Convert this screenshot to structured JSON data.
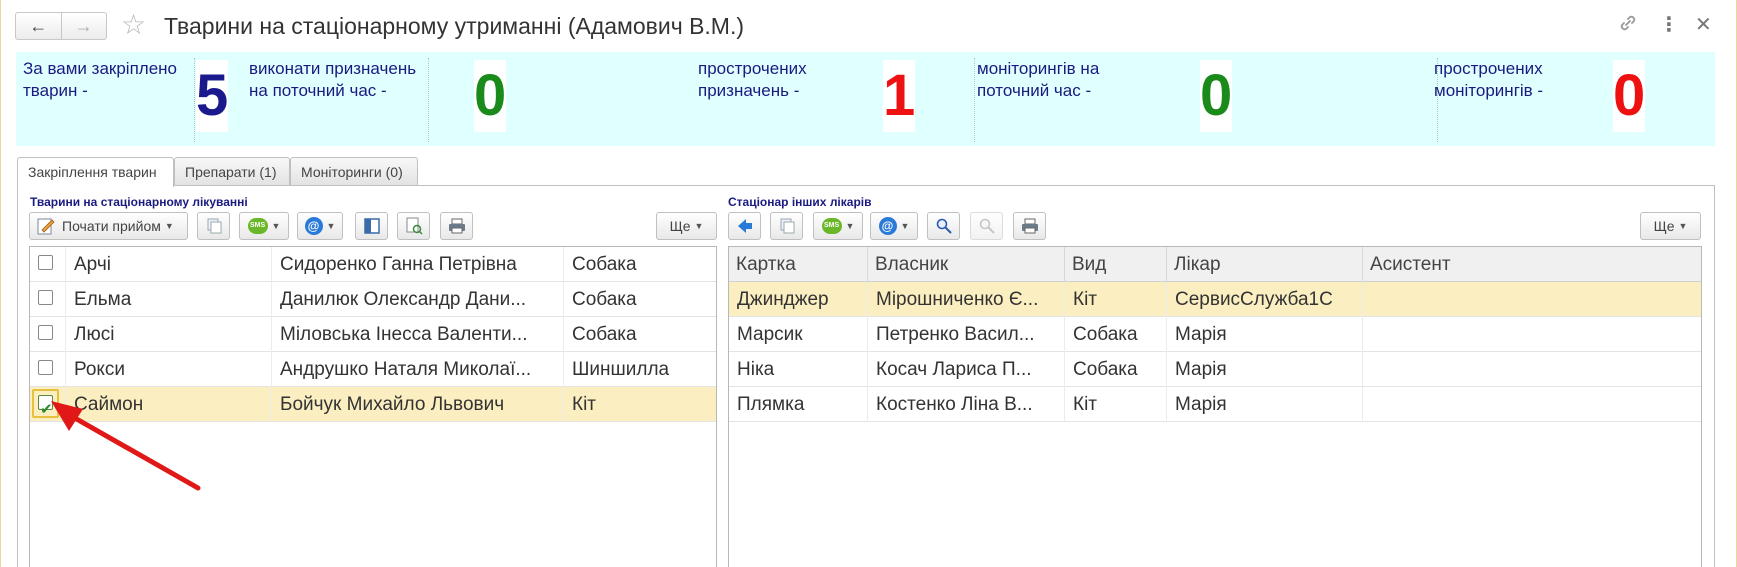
{
  "window": {
    "title": "Тварини на стаціонарному утриманні (Адамович В.М.)",
    "back_icon": "←",
    "forward_icon": "→",
    "favorite_icon": "☆",
    "link_icon": "🔗",
    "menu_icon": "⋮",
    "close_icon": "✕"
  },
  "info": {
    "assigned": {
      "label": "За вами закріплено тварин -",
      "value": "5",
      "color": "#1a1a8c"
    },
    "todo_appointments": {
      "label": "виконати призначень на поточний час -",
      "value": "0",
      "color": "#1a8a1a"
    },
    "overdue_appointments": {
      "label": "прострочених призначень -",
      "value": "1",
      "color": "#ee1111"
    },
    "monitorings_now": {
      "label": "моніторингів на поточний час -",
      "value": "0",
      "color": "#1a8a1a"
    },
    "overdue_monitorings": {
      "label": "прострочених моніторингів -",
      "value": "0",
      "color": "#ee1111"
    }
  },
  "tabs": [
    {
      "label": "Закріплення тварин",
      "active": true
    },
    {
      "label": "Препарати (1)",
      "active": false
    },
    {
      "label": "Моніторинги (0)",
      "active": false
    }
  ],
  "left": {
    "group_label": "Тварини на стаціонарному лікуванні",
    "toolbar": {
      "start_appointment": "Почати прийом",
      "more": "Ще",
      "sms_label": "SMS",
      "email_label": "@"
    },
    "rows": [
      {
        "checked": false,
        "name": "Арчі",
        "owner": "Сидоренко Ганна Петрівна",
        "species": "Собака",
        "selected": false
      },
      {
        "checked": false,
        "name": "Ельма",
        "owner": "Данилюк Олександр Дани...",
        "species": "Собака",
        "selected": false
      },
      {
        "checked": false,
        "name": "Люсі",
        "owner": "Міловська Інесса Валенти...",
        "species": "Собака",
        "selected": false
      },
      {
        "checked": false,
        "name": "Рокси",
        "owner": "Андрушко Наталя Миколаї...",
        "species": "Шиншилла",
        "selected": false
      },
      {
        "checked": true,
        "name": "Саймон",
        "owner": "Бойчук Михайло Львович",
        "species": "Кіт",
        "selected": true
      }
    ]
  },
  "right": {
    "group_label": "Стаціонар інших лікарів",
    "toolbar": {
      "more": "Ще",
      "sms_label": "SMS",
      "email_label": "@"
    },
    "columns": [
      "Картка",
      "Власник",
      "Вид",
      "Лікар",
      "Асистент"
    ],
    "rows": [
      {
        "card": "Джинджер",
        "owner": "Мірошниченко Є...",
        "species": "Кіт",
        "doctor": "СервисСлужба1С",
        "assistant": "",
        "selected": true
      },
      {
        "card": "Марсик",
        "owner": "Петренко Васил...",
        "species": "Собака",
        "doctor": "Марія",
        "assistant": "",
        "selected": false
      },
      {
        "card": "Ніка",
        "owner": "Косач Лариса П...",
        "species": "Собака",
        "doctor": "Марія",
        "assistant": "",
        "selected": false
      },
      {
        "card": "Плямка",
        "owner": "Костенко Ліна В...",
        "species": "Кіт",
        "doctor": "Марія",
        "assistant": "",
        "selected": false
      }
    ]
  }
}
